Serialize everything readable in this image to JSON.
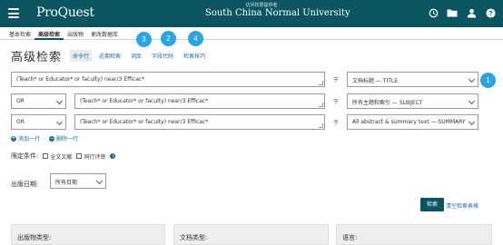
{
  "header": {
    "logo": "ProQuest",
    "provider_label": "访问权限提供者",
    "university": "South China Normal University",
    "icons": [
      "history-icon",
      "folder-icon",
      "user-icon",
      "help-icon"
    ]
  },
  "nav": {
    "tabs": [
      {
        "label": "基本检索"
      },
      {
        "label": "高级检索"
      },
      {
        "label": "出版物"
      },
      {
        "label": "更改数据库"
      }
    ]
  },
  "page_title": "高级检索",
  "subnav": {
    "items": [
      {
        "label": "命令行"
      },
      {
        "label": "近期检索"
      },
      {
        "label": "词库"
      },
      {
        "label": "字段代码"
      },
      {
        "label": "检索技巧"
      }
    ]
  },
  "badges": [
    "3",
    "2",
    "4",
    "1"
  ],
  "rows": [
    {
      "operator": "",
      "query": "(Teach* or Educator* or faculty) near/3 Efficac*",
      "in_label": "于",
      "field": "文档标题 — TITLE"
    },
    {
      "operator": "OR",
      "query": "(Teach* or Educator* or faculty) near/3 Efficac*",
      "in_label": "于",
      "field": "所有主题和索引 — SUBJECT"
    },
    {
      "operator": "OR",
      "query": "(Teach* or Educator* or faculty) near/3 Efficac*",
      "in_label": "于",
      "field": "All abstract & summary text — SUMMARY"
    }
  ],
  "row_actions": {
    "add": "添加一行",
    "remove": "删除一行"
  },
  "limits": {
    "label": "限定条件:",
    "full_text": "全文文献",
    "peer_reviewed": "同行评审"
  },
  "date": {
    "label": "出版日期:",
    "value": "所有日期"
  },
  "actions": {
    "search": "检索",
    "clear": "清空检索表格"
  },
  "panels": [
    {
      "label": "出版物类型:"
    },
    {
      "label": "文档类型:"
    },
    {
      "label": "语言:"
    }
  ],
  "colors": {
    "header": "#0b5561",
    "badge": "#29a4e6",
    "link": "#1f6a8f"
  }
}
